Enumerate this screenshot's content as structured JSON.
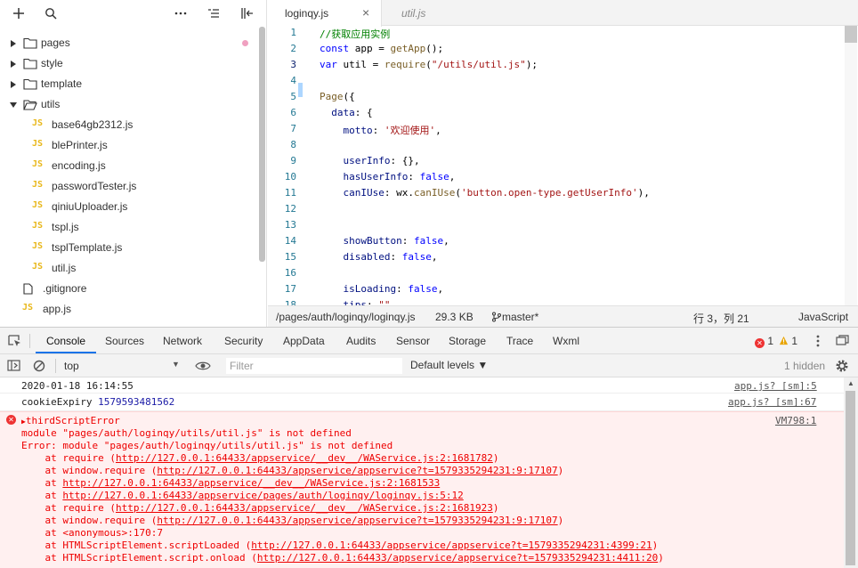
{
  "sidebar": {
    "toolbar": {
      "add_icon": "plus-icon",
      "search_icon": "search-icon",
      "more_icon": "more-horizontal-icon",
      "collapse_icon": "collapse-all-icon",
      "hide_icon": "hide-panel-icon"
    },
    "tree": [
      {
        "label": "pages",
        "type": "folder",
        "expanded": false,
        "modified": true
      },
      {
        "label": "style",
        "type": "folder",
        "expanded": false
      },
      {
        "label": "template",
        "type": "folder",
        "expanded": false
      },
      {
        "label": "utils",
        "type": "folder",
        "expanded": true
      },
      {
        "label": "base64gb2312.js",
        "type": "js",
        "indent": 1
      },
      {
        "label": "blePrinter.js",
        "type": "js",
        "indent": 1
      },
      {
        "label": "encoding.js",
        "type": "js",
        "indent": 1
      },
      {
        "label": "passwordTester.js",
        "type": "js",
        "indent": 1
      },
      {
        "label": "qiniuUploader.js",
        "type": "js",
        "indent": 1
      },
      {
        "label": "tspl.js",
        "type": "js",
        "indent": 1
      },
      {
        "label": "tsplTemplate.js",
        "type": "js",
        "indent": 1
      },
      {
        "label": "util.js",
        "type": "js",
        "indent": 1
      },
      {
        "label": ".gitignore",
        "type": "file"
      },
      {
        "label": "app.js",
        "type": "js"
      }
    ],
    "js_badge": "JS"
  },
  "editor": {
    "tabs": [
      {
        "name": "loginqy.js",
        "active": true,
        "close": "×"
      },
      {
        "name": "util.js",
        "active": false
      }
    ],
    "lines": [
      {
        "n": "1",
        "tokens": [
          [
            "c-comment",
            "//获取应用实例"
          ]
        ]
      },
      {
        "n": "2",
        "tokens": [
          [
            "c-kw",
            "const"
          ],
          [
            "",
            " app = "
          ],
          [
            "c-fn",
            "getApp"
          ],
          [
            "",
            "();"
          ]
        ]
      },
      {
        "n": "3",
        "tokens": [
          [
            "c-kw",
            "var"
          ],
          [
            "",
            " util = "
          ],
          [
            "c-fn",
            "require"
          ],
          [
            "",
            "("
          ],
          [
            "c-str",
            "\"/utils/util.js\""
          ],
          [
            "",
            ");"
          ]
        ]
      },
      {
        "n": "4",
        "tokens": []
      },
      {
        "n": "5",
        "tokens": [
          [
            "c-fn",
            "Page"
          ],
          [
            "",
            "({"
          ]
        ]
      },
      {
        "n": "6",
        "tokens": [
          [
            "",
            "  "
          ],
          [
            "c-prop",
            "data"
          ],
          [
            "",
            ": {"
          ]
        ]
      },
      {
        "n": "7",
        "tokens": [
          [
            "",
            "    "
          ],
          [
            "c-prop",
            "motto"
          ],
          [
            "",
            ": "
          ],
          [
            "c-str",
            "'欢迎使用'"
          ],
          [
            "",
            ","
          ]
        ]
      },
      {
        "n": "8",
        "tokens": []
      },
      {
        "n": "9",
        "tokens": [
          [
            "",
            "    "
          ],
          [
            "c-prop",
            "userInfo"
          ],
          [
            "",
            ": {},"
          ]
        ]
      },
      {
        "n": "10",
        "tokens": [
          [
            "",
            "    "
          ],
          [
            "c-prop",
            "hasUserInfo"
          ],
          [
            "",
            ": "
          ],
          [
            "c-kw",
            "false"
          ],
          [
            "",
            ","
          ]
        ]
      },
      {
        "n": "11",
        "tokens": [
          [
            "",
            "    "
          ],
          [
            "c-prop",
            "canIUse"
          ],
          [
            "",
            ": wx."
          ],
          [
            "c-fn",
            "canIUse"
          ],
          [
            "",
            "("
          ],
          [
            "c-str",
            "'button.open-type.getUserInfo'"
          ],
          [
            "",
            "),"
          ]
        ]
      },
      {
        "n": "12",
        "tokens": []
      },
      {
        "n": "13",
        "tokens": []
      },
      {
        "n": "14",
        "tokens": [
          [
            "",
            "    "
          ],
          [
            "c-prop",
            "showButton"
          ],
          [
            "",
            ": "
          ],
          [
            "c-kw",
            "false"
          ],
          [
            "",
            ","
          ]
        ]
      },
      {
        "n": "15",
        "tokens": [
          [
            "",
            "    "
          ],
          [
            "c-prop",
            "disabled"
          ],
          [
            "",
            ": "
          ],
          [
            "c-kw",
            "false"
          ],
          [
            "",
            ","
          ]
        ]
      },
      {
        "n": "16",
        "tokens": []
      },
      {
        "n": "17",
        "tokens": [
          [
            "",
            "    "
          ],
          [
            "c-prop",
            "isLoading"
          ],
          [
            "",
            ": "
          ],
          [
            "c-kw",
            "false"
          ],
          [
            "",
            ","
          ]
        ]
      },
      {
        "n": "18",
        "tokens": [
          [
            "",
            "    "
          ],
          [
            "c-prop",
            "tips"
          ],
          [
            "",
            ": "
          ],
          [
            "c-str",
            "\"\""
          ]
        ]
      }
    ],
    "current_line": "3",
    "status": {
      "path": "/pages/auth/loginqy/loginqy.js",
      "size": "29.3 KB",
      "branch": "master*",
      "cursor": "行 3，列 21",
      "language": "JavaScript"
    }
  },
  "devtools": {
    "tabs": [
      "Console",
      "Sources",
      "Network",
      "Security",
      "AppData",
      "Audits",
      "Sensor",
      "Storage",
      "Trace",
      "Wxml"
    ],
    "active_tab": "Console",
    "error_count": "1",
    "warning_count": "1",
    "context": "top",
    "filter_placeholder": "Filter",
    "levels": "Default levels ▼",
    "hidden": "1 hidden",
    "messages": [
      {
        "text": "2020-01-18 16:14:55",
        "source": "app.js? [sm]:5"
      },
      {
        "text": "cookieExpiry 1579593481562",
        "source": "app.js? [sm]:67"
      }
    ],
    "error": {
      "title": "thirdScriptError",
      "source": "VM798:1",
      "lines": [
        {
          "pre": "module \"pages/auth/loginqy/utils/util.js\" is not defined",
          "link": "",
          "post": ""
        },
        {
          "pre": "Error: module \"pages/auth/loginqy/utils/util.js\" is not defined",
          "link": "",
          "post": ""
        },
        {
          "pre": "    at require (",
          "link": "http://127.0.0.1:64433/appservice/__dev__/WAService.js:2:1681782",
          "post": ")"
        },
        {
          "pre": "    at window.require (",
          "link": "http://127.0.0.1:64433/appservice/appservice?t=1579335294231:9:17107",
          "post": ")"
        },
        {
          "pre": "    at ",
          "link": "http://127.0.0.1:64433/appservice/__dev__/WAService.js:2:1681533",
          "post": ""
        },
        {
          "pre": "    at ",
          "link": "http://127.0.0.1:64433/appservice/pages/auth/loginqy/loginqy.js:5:12",
          "post": ""
        },
        {
          "pre": "    at require (",
          "link": "http://127.0.0.1:64433/appservice/__dev__/WAService.js:2:1681923",
          "post": ")"
        },
        {
          "pre": "    at window.require (",
          "link": "http://127.0.0.1:64433/appservice/appservice?t=1579335294231:9:17107",
          "post": ")"
        },
        {
          "pre": "    at <anonymous>:170:7",
          "link": "",
          "post": ""
        },
        {
          "pre": "    at HTMLScriptElement.scriptLoaded (",
          "link": "http://127.0.0.1:64433/appservice/appservice?t=1579335294231:4399:21",
          "post": ")"
        },
        {
          "pre": "    at HTMLScriptElement.script.onload (",
          "link": "http://127.0.0.1:64433/appservice/appservice?t=1579335294231:4411:20",
          "post": ")"
        }
      ]
    },
    "colors": {
      "accent": "#1a73e8",
      "error": "#e00000",
      "warning": "#e8a400"
    }
  }
}
